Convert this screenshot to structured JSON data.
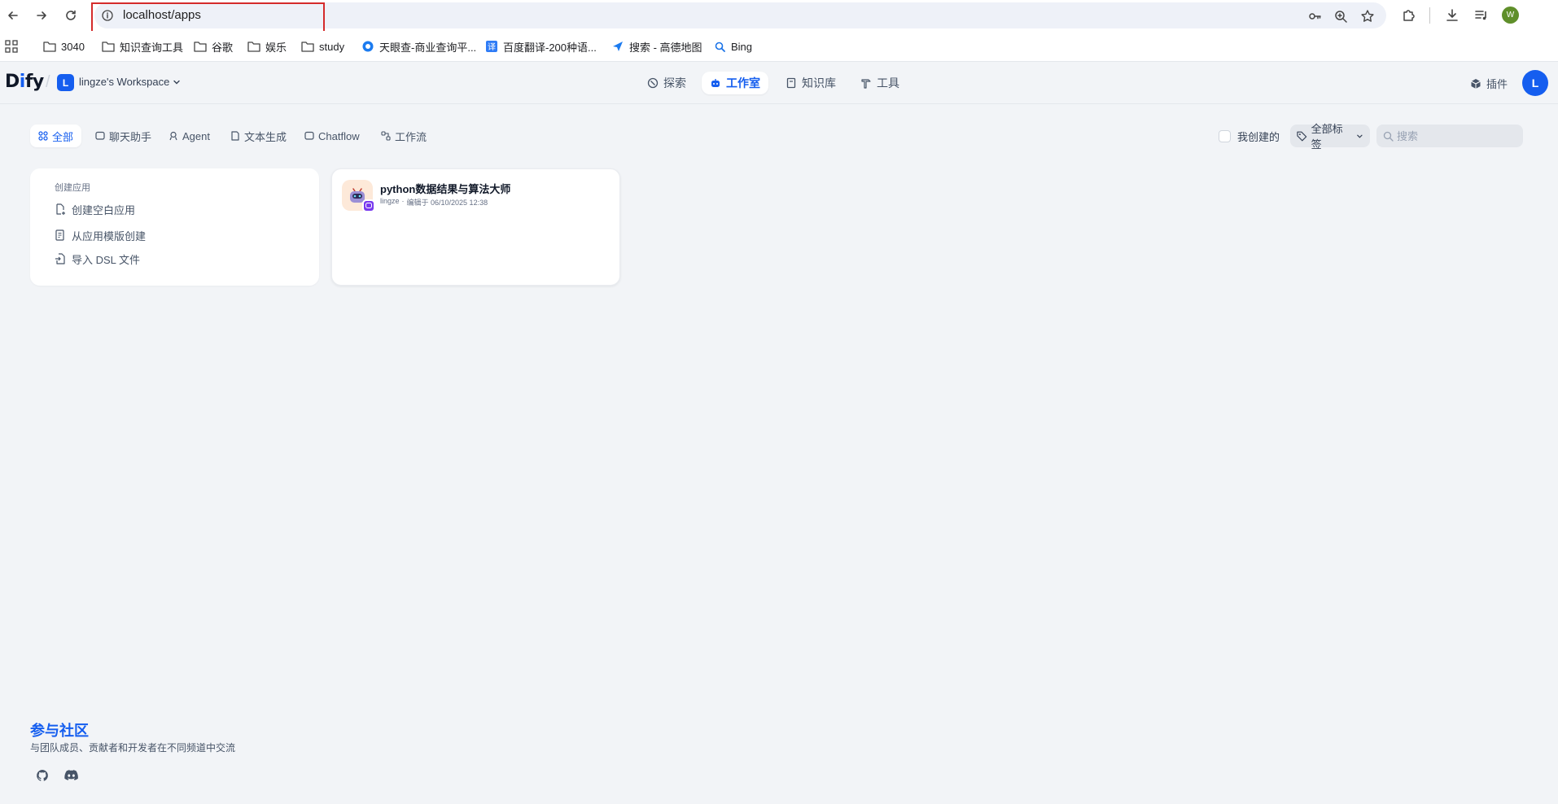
{
  "browser": {
    "url": "localhost/apps",
    "profile_initial": "W",
    "bookmarks": [
      {
        "label": "3040",
        "icon": "folder-icon"
      },
      {
        "label": "知识查询工具",
        "icon": "folder-icon"
      },
      {
        "label": "谷歌",
        "icon": "folder-icon"
      },
      {
        "label": "娱乐",
        "icon": "folder-icon"
      },
      {
        "label": "study",
        "icon": "folder-icon"
      },
      {
        "label": "天眼查-商业查询平...",
        "icon": "tianyancha-icon"
      },
      {
        "label": "百度翻译-200种语...",
        "icon": "baidu-translate-icon"
      },
      {
        "label": "搜索 - 高德地图",
        "icon": "amap-icon"
      },
      {
        "label": "Bing",
        "icon": "bing-search-icon"
      }
    ],
    "colors": {
      "highlight": "#d42b2b"
    }
  },
  "header": {
    "logo_left": "D",
    "logo_accent": "i",
    "logo_right": "fy",
    "workspace_initial": "L",
    "workspace_name": "lingze's Workspace",
    "nav": [
      {
        "label": "探索",
        "icon": "compass-icon"
      },
      {
        "label": "工作室",
        "icon": "robot-icon",
        "active": true
      },
      {
        "label": "知识库",
        "icon": "book-icon"
      },
      {
        "label": "工具",
        "icon": "hammer-icon"
      }
    ],
    "plugins_label": "插件",
    "user_initial": "L"
  },
  "filters": {
    "tabs": [
      {
        "label": "全部",
        "icon": "grid-icon",
        "active": true
      },
      {
        "label": "聊天助手",
        "icon": "chat-icon"
      },
      {
        "label": "Agent",
        "icon": "agent-icon"
      },
      {
        "label": "文本生成",
        "icon": "text-icon"
      },
      {
        "label": "Chatflow",
        "icon": "chatflow-icon"
      },
      {
        "label": "工作流",
        "icon": "workflow-icon"
      }
    ],
    "mine_label": "我创建的",
    "tags_label": "全部标签",
    "search_placeholder": "搜索"
  },
  "create": {
    "title": "创建应用",
    "items": [
      {
        "label": "创建空白应用",
        "icon": "file-plus-icon"
      },
      {
        "label": "从应用模版创建",
        "icon": "template-icon"
      },
      {
        "label": "导入 DSL 文件",
        "icon": "import-icon"
      }
    ]
  },
  "apps": [
    {
      "name": "python数据结果与算法大师",
      "author": "lingze",
      "sep": "·",
      "edited": "编辑于 06/10/2025 12:38"
    }
  ],
  "footer": {
    "community_title": "参与社区",
    "community_desc": "与团队成员、贡献者和开发者在不同频道中交流"
  },
  "colors": {
    "accent": "#155eef",
    "background": "#f2f4f7",
    "app_badge": "#7839ee"
  }
}
